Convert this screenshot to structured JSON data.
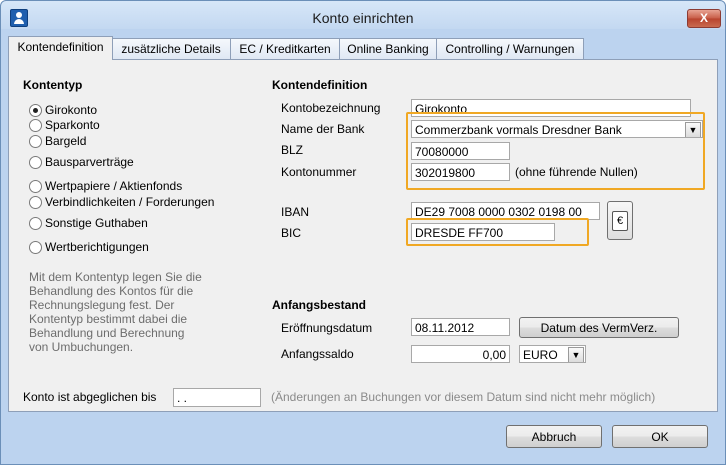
{
  "window": {
    "title": "Konto einrichten",
    "close_label": "X"
  },
  "tabs": [
    {
      "label": "Kontendefinition"
    },
    {
      "label": "zusätzliche Details"
    },
    {
      "label": "EC / Kreditkarten"
    },
    {
      "label": "Online Banking"
    },
    {
      "label": "Controlling / Warnungen"
    }
  ],
  "kontentyp": {
    "heading": "Kontentyp",
    "options": [
      {
        "label": "Girokonto",
        "checked": true
      },
      {
        "label": "Sparkonto"
      },
      {
        "label": "Bargeld"
      },
      {
        "label": "Bausparverträge"
      },
      {
        "label": "Wertpapiere / Aktienfonds"
      },
      {
        "label": "Verbindlichkeiten / Forderungen"
      },
      {
        "label": "Sonstige Guthaben"
      },
      {
        "label": "Wertberichtigungen"
      }
    ],
    "help_lines": [
      "Mit dem Kontentyp legen Sie die",
      "Behandlung des Kontos für die",
      "Rechnungslegung fest. Der",
      "Kontentyp bestimmt dabei die",
      "Behandlung und Berechnung",
      "von Umbuchungen."
    ]
  },
  "definition": {
    "heading": "Kontendefinition",
    "kontobezeichnung_label": "Kontobezeichnung",
    "kontobezeichnung_value": "Girokonto",
    "bank_label": "Name der Bank",
    "bank_value": "Commerzbank vormals Dresdner Bank",
    "blz_label": "BLZ",
    "blz_value": "70080000",
    "kontonummer_label": "Kontonummer",
    "kontonummer_value": "302019800",
    "kontonummer_hint": "(ohne führende Nullen)",
    "iban_label": "IBAN",
    "iban_value": "DE29 7008 0000 0302 0198 00",
    "bic_label": "BIC",
    "bic_value": "DRESDE FF700",
    "euro_button": "€"
  },
  "anfangsbestand": {
    "heading": "Anfangsbestand",
    "datum_label": "Eröffnungsdatum",
    "datum_value": "08.11.2012",
    "datum_button": "Datum des VermVerz.",
    "saldo_label": "Anfangssaldo",
    "saldo_value": "0,00",
    "currency_value": "EURO"
  },
  "abgleich": {
    "label": "Konto ist abgeglichen bis",
    "value": " .  .",
    "hint": "(Änderungen an Buchungen vor diesem Datum sind nicht mehr möglich)"
  },
  "buttons": {
    "cancel": "Abbruch",
    "ok": "OK"
  },
  "colors": {
    "highlight": "#f0a824",
    "titlebar": "#c3d8f1"
  }
}
